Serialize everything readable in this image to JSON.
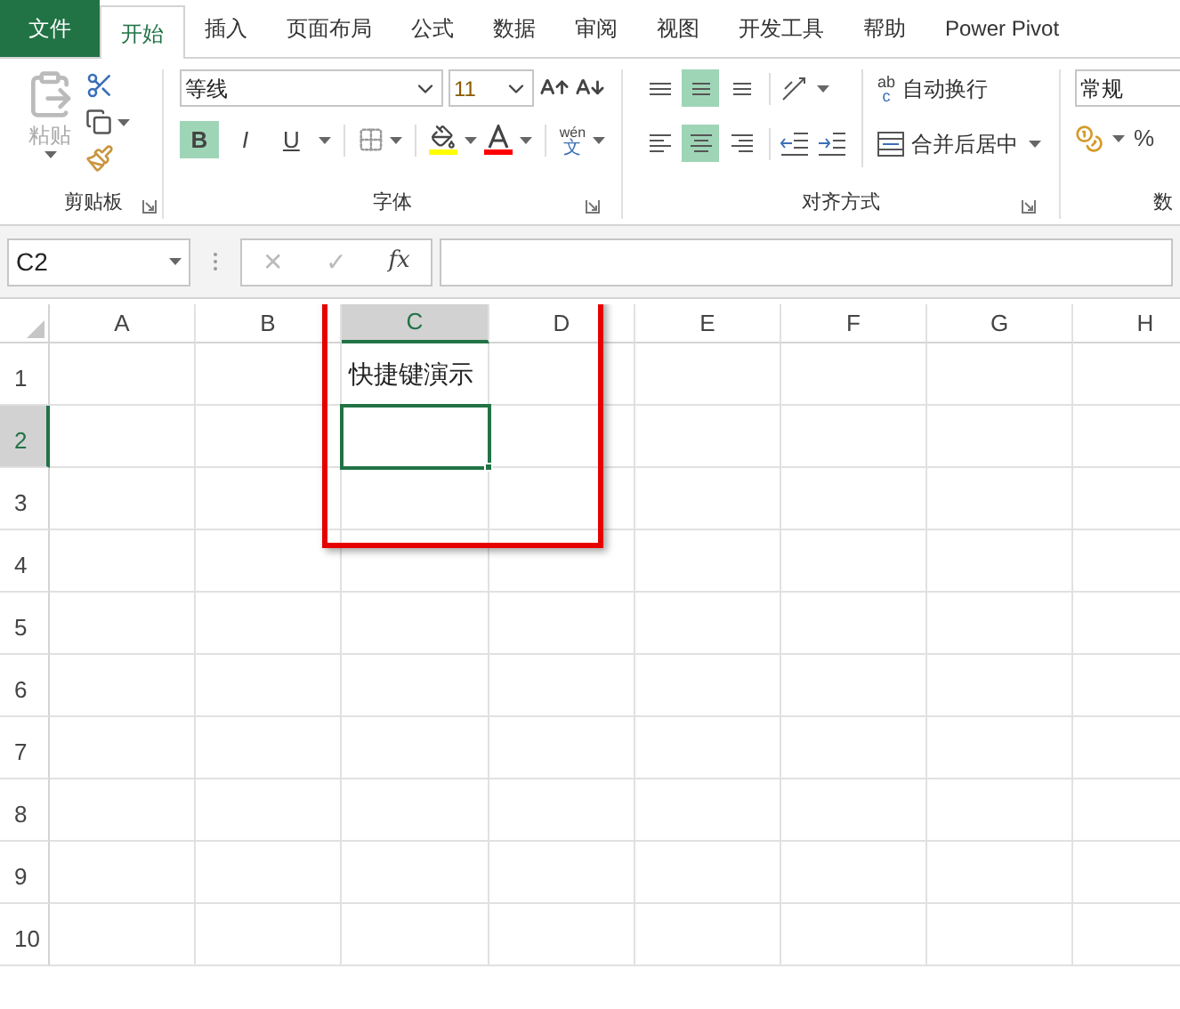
{
  "tabs": [
    {
      "label": "文件",
      "kind": "file",
      "selected": false
    },
    {
      "label": "开始",
      "kind": "tab",
      "selected": true
    },
    {
      "label": "插入",
      "kind": "tab",
      "selected": false
    },
    {
      "label": "页面布局",
      "kind": "tab",
      "selected": false
    },
    {
      "label": "公式",
      "kind": "tab",
      "selected": false
    },
    {
      "label": "数据",
      "kind": "tab",
      "selected": false
    },
    {
      "label": "审阅",
      "kind": "tab",
      "selected": false
    },
    {
      "label": "视图",
      "kind": "tab",
      "selected": false
    },
    {
      "label": "开发工具",
      "kind": "tab",
      "selected": false
    },
    {
      "label": "帮助",
      "kind": "tab",
      "selected": false
    },
    {
      "label": "Power Pivot",
      "kind": "tab",
      "selected": false
    }
  ],
  "ribbon": {
    "clipboard": {
      "label": "剪贴板",
      "paste": "粘贴"
    },
    "font": {
      "label": "字体",
      "font_name": "等线",
      "font_size": "11",
      "bold": {
        "text": "B",
        "selected": true
      },
      "italic": {
        "text": "I",
        "selected": false
      },
      "underline": {
        "text": "U",
        "selected": false
      },
      "phonetic_top": "wén",
      "phonetic_bottom": "文"
    },
    "alignment": {
      "label": "对齐方式",
      "vertical": [
        {
          "kind": "top",
          "selected": false
        },
        {
          "kind": "middle",
          "selected": true
        },
        {
          "kind": "bottom",
          "selected": false
        }
      ],
      "horizontal": [
        {
          "kind": "left",
          "selected": false
        },
        {
          "kind": "center",
          "selected": true
        },
        {
          "kind": "right",
          "selected": false
        }
      ],
      "wrap_icon_top": "ab",
      "wrap_icon_bottom": "c",
      "wrap_text": "自动换行",
      "merge_center": "合并后居中"
    },
    "number": {
      "label": "数",
      "format": "常规",
      "percent": "%"
    }
  },
  "formula_bar": {
    "name_box": "C2",
    "cancel": "✕",
    "enter": "✓",
    "function": "fx"
  },
  "sheet": {
    "columns": [
      {
        "label": "A",
        "selected": false
      },
      {
        "label": "B",
        "selected": false
      },
      {
        "label": "C",
        "selected": true
      },
      {
        "label": "D",
        "selected": false
      },
      {
        "label": "E",
        "selected": false
      },
      {
        "label": "F",
        "selected": false
      },
      {
        "label": "G",
        "selected": false
      },
      {
        "label": "H",
        "selected": false
      }
    ],
    "rows": [
      {
        "label": "1",
        "selected": false,
        "cells": [
          {},
          {},
          {
            "text": "快捷键演示"
          }
        ]
      },
      {
        "label": "2",
        "selected": true
      },
      {
        "label": "3",
        "selected": false
      },
      {
        "label": "4",
        "selected": false
      },
      {
        "label": "5",
        "selected": false
      },
      {
        "label": "6",
        "selected": false
      },
      {
        "label": "7",
        "selected": false
      },
      {
        "label": "8",
        "selected": false
      },
      {
        "label": "9",
        "selected": false
      },
      {
        "label": "10",
        "selected": false
      }
    ],
    "highlight_box": true
  }
}
